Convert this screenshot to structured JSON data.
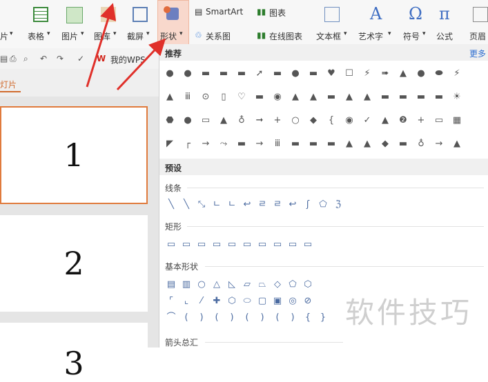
{
  "ribbon": {
    "items": [
      {
        "label": "片",
        "key": "frag"
      },
      {
        "label": "表格",
        "key": "table"
      },
      {
        "label": "图片",
        "key": "image"
      },
      {
        "label": "图库",
        "key": "gallery"
      },
      {
        "label": "截屏",
        "key": "screenshot"
      },
      {
        "label": "形状",
        "key": "shape"
      },
      {
        "label": "文本框",
        "key": "textbox"
      },
      {
        "label": "艺术字",
        "key": "wordart"
      },
      {
        "label": "符号",
        "key": "symbol"
      },
      {
        "label": "公式",
        "key": "formula"
      },
      {
        "label": "页眉",
        "key": "header"
      }
    ],
    "smartart": "SmartArt",
    "chart": "图表",
    "relation": "关系图",
    "online_chart": "在线图表",
    "dropdown_glyph": "▾",
    "accent": "#e06a3c"
  },
  "quick_access": {
    "wps_label": "我的WPS"
  },
  "slides": {
    "panel_label": "灯片",
    "items": [
      {
        "number": "1"
      },
      {
        "number": "2"
      },
      {
        "number": "3"
      }
    ],
    "selected_border": "#e07a3c"
  },
  "shapes_menu": {
    "recommend_title": "推荐",
    "more_label": "更多",
    "preset_title": "预设",
    "lines_title": "线条",
    "rect_title": "矩形",
    "basic_title": "基本形状",
    "arrows_title": "箭头总汇",
    "recommend_rows": [
      "●●▬▬▬➚▬●▬♥☐⚡➠▲●⬬⚡",
      "▲ⅲ⊙▯♡▬◉▲▲▬▲▲▬▬▬▬☀",
      "⬣●▭▲♁➞+○◆{◉✓▲❷+▭▦",
      "◤┌→⤳▬→ⅲ▬▬▬▲▲◆▬♁→▲"
    ],
    "lines_row": "╲╲⤡ㄴㄴ↩ㄹㄹ↩ʃ⬠ℨ",
    "rect_row": "▭▭▭▭▭▭▭▭▭▭",
    "basic_rows": [
      "▤▥○△◺▱⏢◇⬠⬡",
      "⌜⌞⁄✚⬡⬭▢▣◎⊘",
      "⌒()()()(){}"
    ]
  },
  "watermark": "软件技巧"
}
